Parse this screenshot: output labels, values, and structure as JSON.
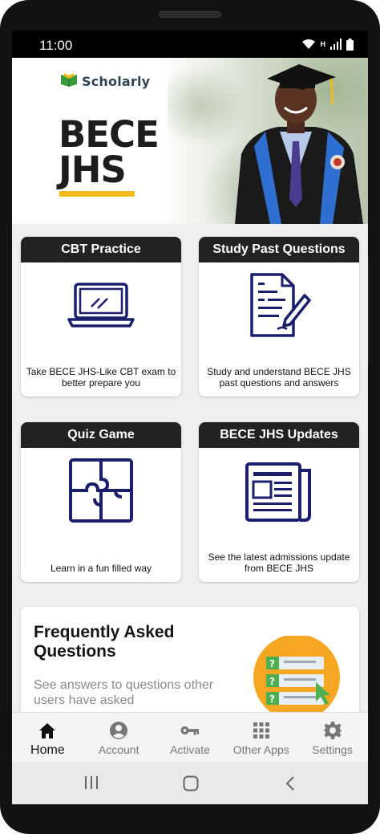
{
  "status_bar": {
    "time": "11:00",
    "icons": [
      "wifi-icon",
      "signal-icon",
      "battery-icon"
    ],
    "network_label": "H"
  },
  "hero": {
    "logo_text": "Scholarly",
    "title_line1": "BECE",
    "title_line2": "JHS",
    "accent_color": "#f1bb1c"
  },
  "cards": [
    {
      "title": "CBT Practice",
      "description": "Take BECE JHS-Like CBT exam to better prepare you",
      "icon": "laptop-icon"
    },
    {
      "title": "Study Past Questions",
      "description": "Study and understand BECE JHS past questions and answers",
      "icon": "document-pen-icon"
    },
    {
      "title": "Quiz Game",
      "description": "Learn in a fun filled way",
      "icon": "puzzle-icon"
    },
    {
      "title": "BECE JHS Updates",
      "description": "See the latest admissions update from BECE JHS",
      "icon": "newspaper-icon"
    }
  ],
  "faq": {
    "title": "Frequently Asked Questions",
    "subtitle": "See answers to questions other users have asked"
  },
  "bottom_nav": {
    "items": [
      {
        "label": "Home",
        "icon": "home-icon",
        "active": true
      },
      {
        "label": "Account",
        "icon": "account-icon",
        "active": false
      },
      {
        "label": "Activate",
        "icon": "key-icon",
        "active": false
      },
      {
        "label": "Other Apps",
        "icon": "apps-grid-icon",
        "active": false
      },
      {
        "label": "Settings",
        "icon": "gear-icon",
        "active": false
      }
    ]
  },
  "system_nav": [
    "recents-icon",
    "home-circle-icon",
    "back-icon"
  ],
  "colors": {
    "icon_navy": "#1b1f6b",
    "card_header": "#222222",
    "accent_yellow": "#f1bb1c",
    "faq_orange": "#f5a623",
    "faq_green": "#4caf50"
  }
}
